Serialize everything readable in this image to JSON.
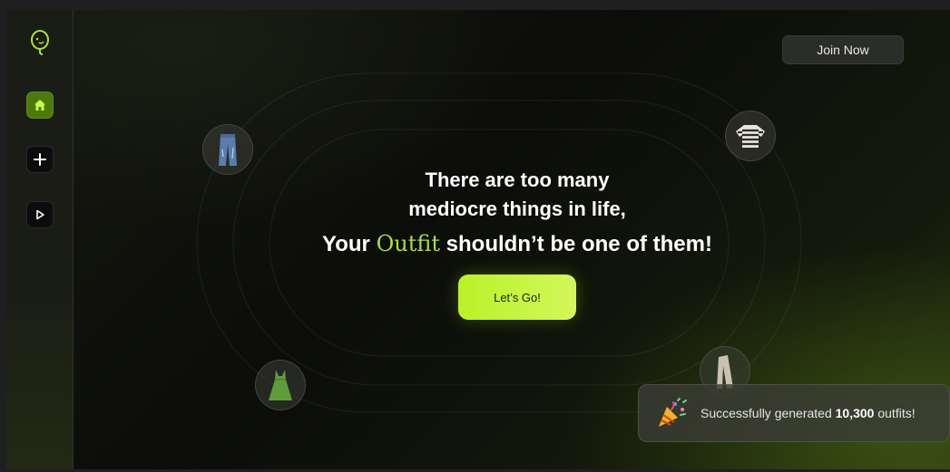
{
  "sidebar": {
    "logo": "balloon-face-logo",
    "items": [
      {
        "name": "home",
        "icon": "home-icon",
        "active": true
      },
      {
        "name": "add",
        "icon": "plus-icon",
        "active": false
      },
      {
        "name": "play",
        "icon": "play-icon",
        "active": false
      }
    ]
  },
  "header": {
    "join_label": "Join Now"
  },
  "hero": {
    "line1": "There are too many",
    "line2": "mediocre things in life,",
    "line3_prefix": "Your ",
    "line3_accent": "Outfit",
    "line3_suffix": " shouldn’t be one of them!",
    "cta_label": "Let’s Go!"
  },
  "orbit_items": [
    {
      "name": "jeans",
      "icon": "jeans-icon"
    },
    {
      "name": "striped-sweater",
      "icon": "sweater-icon"
    },
    {
      "name": "green-dress",
      "icon": "dress-icon"
    },
    {
      "name": "trousers",
      "icon": "trousers-icon"
    }
  ],
  "toast": {
    "icon": "party-popper-icon",
    "prefix": "Successfully generated ",
    "count": "10,300",
    "suffix": " outfits!"
  },
  "colors": {
    "accent": "#a9e233",
    "cta_start": "#b9f227",
    "cta_end": "#d3f75a",
    "active_nav": "#4b7a0c"
  }
}
